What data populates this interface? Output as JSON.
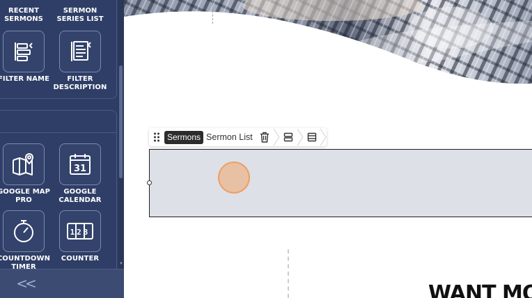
{
  "sidebar": {
    "top_widgets": [
      {
        "label": "RECENT\nSERMONS",
        "icon": "recent-sermons-icon"
      },
      {
        "label": "SERMON\nSERIES LIST",
        "icon": "sermon-series-list-icon"
      },
      {
        "label": "FILTER NAME",
        "icon": "filter-name-icon"
      },
      {
        "label": "FILTER\nDESCRIPTION",
        "icon": "filter-description-icon"
      }
    ],
    "bottom_widgets": [
      {
        "label": "GOOGLE MAP\nPRO",
        "icon": "google-map-icon"
      },
      {
        "label": "GOOGLE\nCALENDAR",
        "icon": "calendar-icon",
        "icon_text": "31"
      },
      {
        "label": "COUNTDOWN\nTIMER",
        "icon": "stopwatch-icon"
      },
      {
        "label": "COUNTER",
        "icon": "counter-icon",
        "icon_text": "123"
      }
    ],
    "collapse_label": "<<"
  },
  "canvas": {
    "toolbar": {
      "chip_label": "Sermons",
      "widget_name": "Sermon List",
      "icons": [
        "drag-handle-icon",
        "trash-icon",
        "section-icon",
        "column-icon"
      ]
    },
    "heading_text": "WANT MO"
  },
  "colors": {
    "sidebar_bg": "#2d3d63",
    "tile_border": "#7d8ab0",
    "widget_placeholder": "#dde0e6",
    "cursor_highlight": "#f0a56e"
  }
}
